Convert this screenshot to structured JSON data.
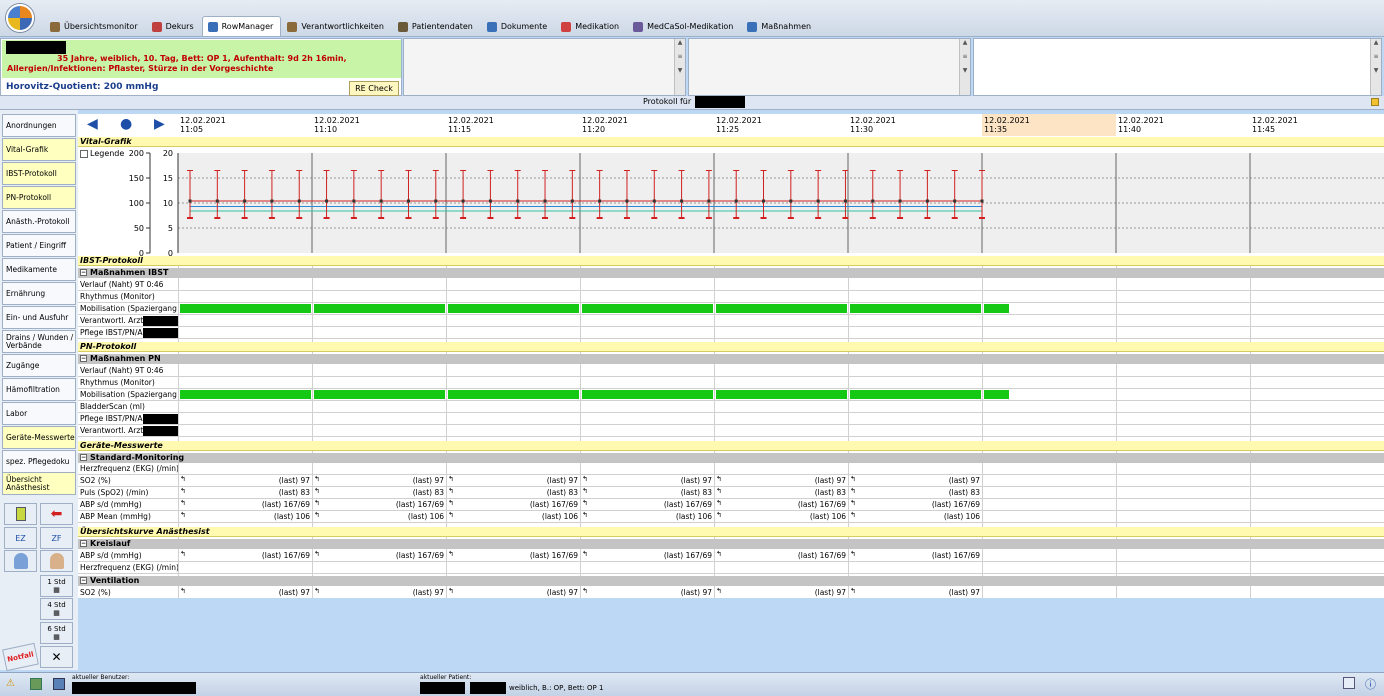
{
  "tabs": [
    {
      "label": "Übersichtsmonitor",
      "icon": "monitor-icon"
    },
    {
      "label": "Dekurs",
      "icon": "pen-icon"
    },
    {
      "label": "RowManager",
      "icon": "rowmanager-icon"
    },
    {
      "label": "Verantwortlichkeiten",
      "icon": "people-icon"
    },
    {
      "label": "Patientendaten",
      "icon": "patient-icon"
    },
    {
      "label": "Dokumente",
      "icon": "document-icon"
    },
    {
      "label": "Medikation",
      "icon": "syringe-icon"
    },
    {
      "label": "MedCaSol-Medikation",
      "icon": "medcasol-icon"
    },
    {
      "label": "Maßnahmen",
      "icon": "measures-icon"
    }
  ],
  "active_tab": "RowManager",
  "patient": {
    "info1": "35 Jahre, weiblich, 10. Tag, Bett: OP 1, Aufenthalt: 9d 2h 16min,",
    "info2": "Allergien/Infektionen: Pflaster, Stürze in der Vorgeschichte",
    "horovitz": "Horovitz-Quotient: 200 mmHg",
    "recheck": "RE Check"
  },
  "protocol_label": "Protokoll für",
  "sidebar": [
    {
      "label": "Anordnungen",
      "highlight": false
    },
    {
      "label": "Vital-Grafik",
      "highlight": true
    },
    {
      "label": "IBST-Protokoll",
      "highlight": true
    },
    {
      "label": "PN-Protokoll",
      "highlight": true
    },
    {
      "label": "Anästh.-Protokoll",
      "highlight": false
    },
    {
      "label": "Patient / Eingriff",
      "highlight": false
    },
    {
      "label": "Medikamente",
      "highlight": false
    },
    {
      "label": "Ernährung",
      "highlight": false
    },
    {
      "label": "Ein- und Ausfuhr",
      "highlight": false
    },
    {
      "label": "Drains / Wunden / Verbände",
      "highlight": false
    },
    {
      "label": "Zugänge",
      "highlight": false
    },
    {
      "label": "Hämofiltration",
      "highlight": false
    },
    {
      "label": "Labor",
      "highlight": false
    },
    {
      "label": "Geräte-Messwerte",
      "highlight": true
    },
    {
      "label": "spez. Pflegedoku",
      "highlight": false
    },
    {
      "label": "Übersicht Anästhesist",
      "highlight": true
    }
  ],
  "tools": {
    "ez": "EZ",
    "zf": "ZF",
    "std1": "1 Std",
    "std4": "4 Std",
    "std6": "6 Std",
    "close": "✕",
    "notfall": "Notfall"
  },
  "times": [
    {
      "date": "12.02.2021",
      "time": "11:05"
    },
    {
      "date": "12.02.2021",
      "time": "11:10"
    },
    {
      "date": "12.02.2021",
      "time": "11:15"
    },
    {
      "date": "12.02.2021",
      "time": "11:20"
    },
    {
      "date": "12.02.2021",
      "time": "11:25"
    },
    {
      "date": "12.02.2021",
      "time": "11:30"
    },
    {
      "date": "12.02.2021",
      "time": "11:35"
    },
    {
      "date": "12.02.2021",
      "time": "11:40"
    },
    {
      "date": "12.02.2021",
      "time": "11:45"
    }
  ],
  "highlight_time_index": 6,
  "sections": {
    "vital": "Vital-Grafik",
    "ibst": "IBST-Protokoll",
    "massnahmen_ibst": "Maßnahmen IBST",
    "pn": "PN-Protokoll",
    "massnahmen_pn": "Maßnahmen PN",
    "geraete": "Geräte-Messwerte",
    "standard": "Standard-Monitoring",
    "uebersicht": "Übersichtskurve Anästhesist",
    "kreislauf": "Kreislauf",
    "ventilation": "Ventilation"
  },
  "legend": "Legende",
  "chart_data": {
    "type": "line",
    "yaxis_left": {
      "ticks": [
        0,
        50,
        100,
        150,
        200
      ],
      "range": [
        0,
        200
      ]
    },
    "yaxis_right": {
      "ticks": [
        0,
        5,
        10,
        15,
        20
      ],
      "range": [
        0,
        20
      ]
    },
    "grid": true,
    "x": [
      "11:05",
      "11:10",
      "11:15",
      "11:20",
      "11:25",
      "11:30",
      "11:35",
      "11:40",
      "11:45"
    ],
    "series": [
      {
        "type": "range",
        "color": "#d02020",
        "values_left": {
          "high": [
            165
          ],
          "mid": [
            104
          ],
          "low": [
            70
          ]
        }
      },
      {
        "color": "#2a8ad8",
        "values_left": [
          93
        ]
      },
      {
        "color": "#30c0a0",
        "values_left": [
          84
        ]
      }
    ]
  },
  "ibst_rows": [
    "Verlauf (Naht) 9T 0:46",
    "Rhythmus (Monitor)",
    "Mobilisation (Spaziergang üb",
    "Verantwortl. Arzt (",
    "Pflege IBST/PN/ANA"
  ],
  "pn_rows": [
    "Verlauf (Naht) 9T 0:46",
    "Rhythmus (Monitor)",
    "Mobilisation (Spaziergang üb",
    "BladderScan (ml)",
    "Pflege IBST/PN/ANA (",
    "Verantwortl. Arzt"
  ],
  "standard_rows": [
    {
      "label": "Herzfrequenz (EKG) (/min)",
      "value": ""
    },
    {
      "label": "SO2 (%)",
      "value": "(last) 97"
    },
    {
      "label": "Puls (SpO2) (/min)",
      "value": "(last) 83"
    },
    {
      "label": "ABP s/d (mmHg)",
      "value": "(last) 167/69"
    },
    {
      "label": "ABP Mean (mmHg)",
      "value": "(last) 106"
    }
  ],
  "kreislauf_rows": [
    {
      "label": "ABP s/d (mmHg)",
      "value": "(last) 167/69"
    },
    {
      "label": "Herzfrequenz (EKG) (/min)",
      "value": ""
    }
  ],
  "ventilation_rows": [
    {
      "label": "SO2 (%)",
      "value": "(last) 97"
    }
  ],
  "status": {
    "user_label": "aktueller Benutzer:",
    "patient_label": "aktueller Patient:",
    "patient_value": "weiblich, B.: OP, Bett: OP 1"
  }
}
